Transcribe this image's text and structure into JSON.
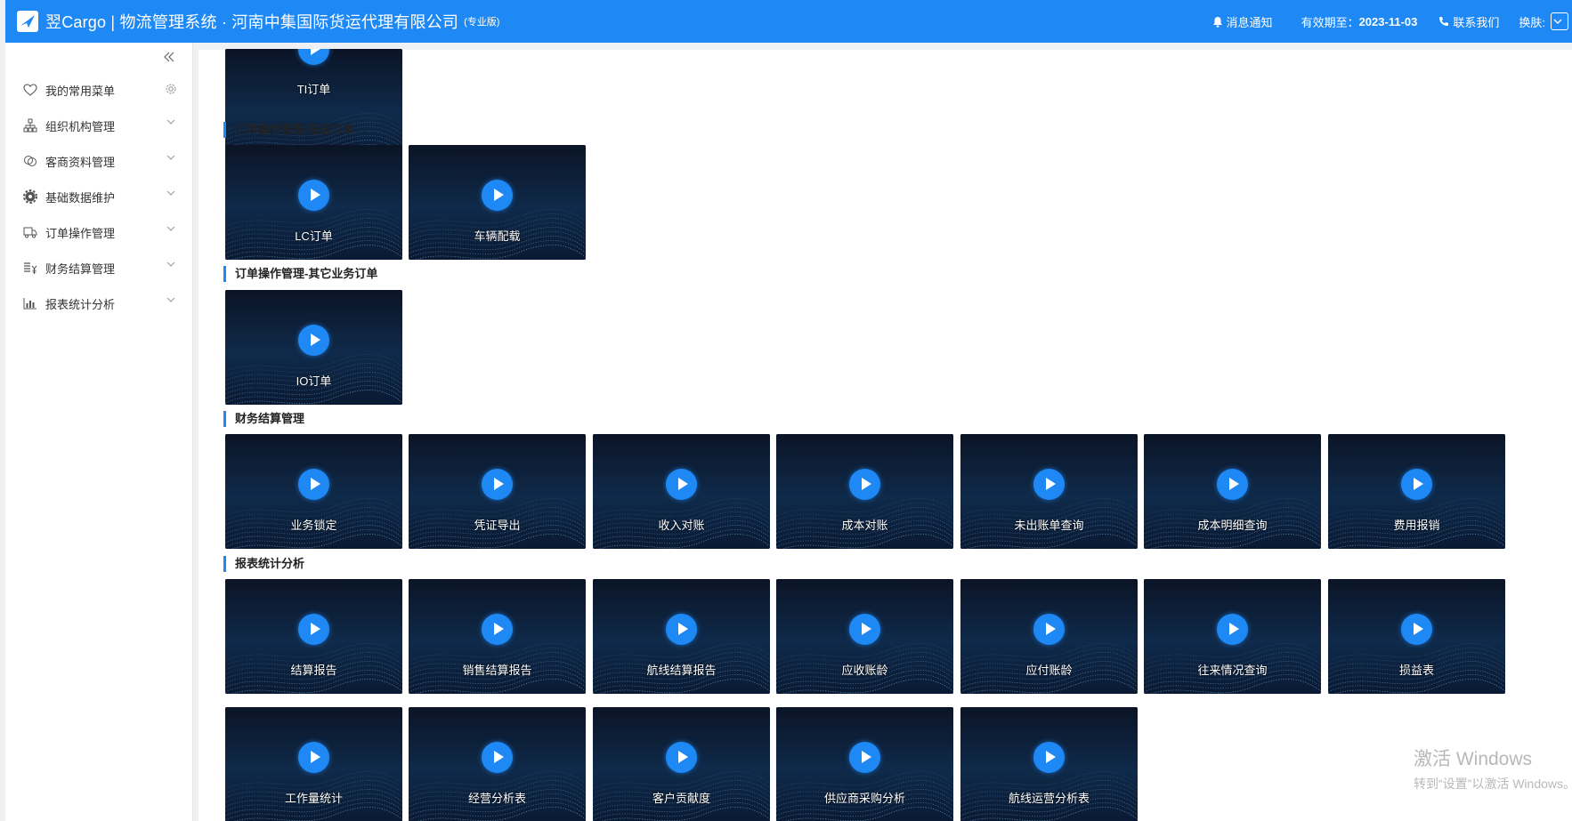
{
  "header": {
    "title": "翌Cargo | 物流管理系统 · 河南中集国际货运代理有限公司",
    "edition": "(专业版)",
    "notification": "消息通知",
    "validity_label": "有效期至：",
    "validity_date": "2023-11-03",
    "contact": "联系我们",
    "skin": "换肤:"
  },
  "sidebar": {
    "items": [
      {
        "label": "我的常用菜单",
        "icon": "heart-icon"
      },
      {
        "label": "组织机构管理",
        "icon": "org-icon"
      },
      {
        "label": "客商资料管理",
        "icon": "chat-icon"
      },
      {
        "label": "基础数据维护",
        "icon": "gear-icon"
      },
      {
        "label": "订单操作管理",
        "icon": "truck-icon"
      },
      {
        "label": "财务结算管理",
        "icon": "finance-icon"
      },
      {
        "label": "报表统计分析",
        "icon": "chart-icon"
      }
    ]
  },
  "sections": [
    {
      "title": "",
      "cards": [
        "TI订单"
      ]
    },
    {
      "title": "订单操作管理-陆运订单",
      "cards": [
        "LC订单",
        "车辆配载"
      ]
    },
    {
      "title": "订单操作管理-其它业务订单",
      "cards": [
        "IO订单"
      ]
    },
    {
      "title": "财务结算管理",
      "cards": [
        "业务锁定",
        "凭证导出",
        "收入对账",
        "成本对账",
        "未出账单查询",
        "成本明细查询",
        "费用报销"
      ]
    },
    {
      "title": "报表统计分析",
      "cards": [
        "结算报告",
        "销售结算报告",
        "航线结算报告",
        "应收账龄",
        "应付账龄",
        "往来情况查询",
        "损益表",
        "工作量统计",
        "经营分析表",
        "客户贡献度",
        "供应商采购分析",
        "航线运营分析表"
      ]
    }
  ],
  "watermark": {
    "line1": "激活 Windows",
    "line2": "转到“设置”以激活 Windows。"
  },
  "colors": {
    "primary": "#1e88f5",
    "card_bg": "#0a1830"
  }
}
